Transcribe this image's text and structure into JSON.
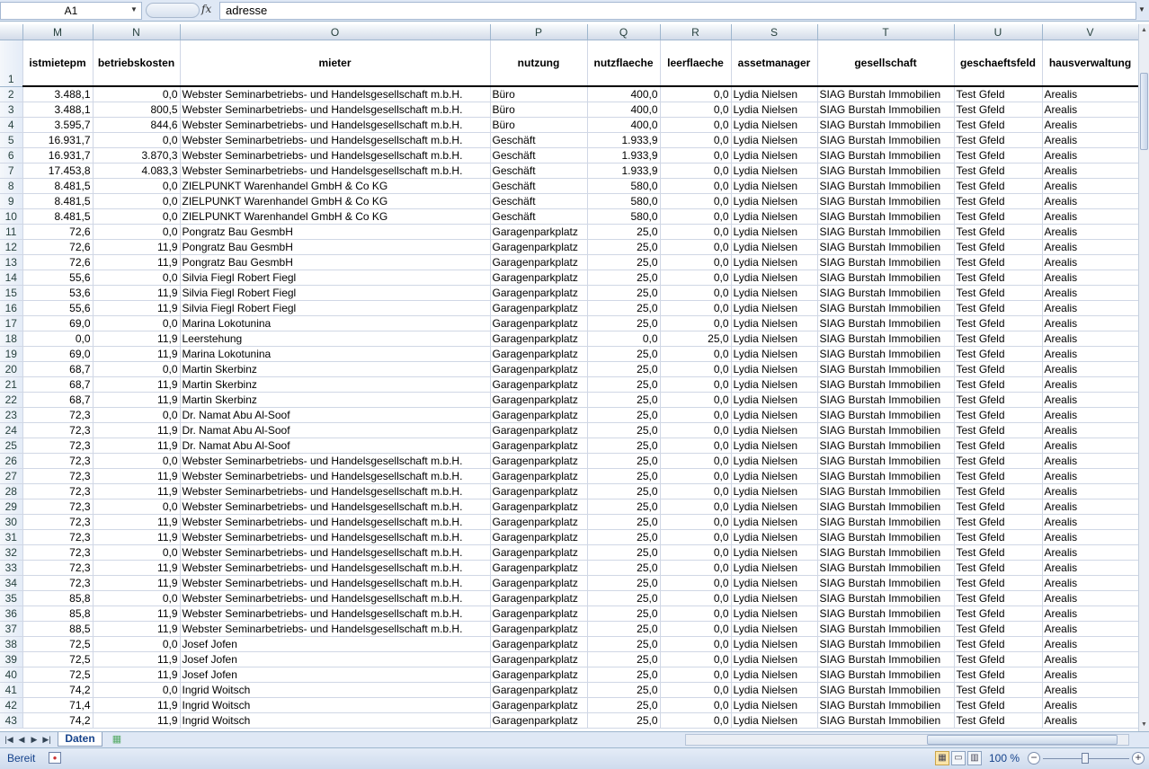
{
  "formula_bar": {
    "name_box": "A1",
    "fx": "fx",
    "content": "adresse"
  },
  "columns": [
    {
      "letter": "M",
      "header": "istmietepm"
    },
    {
      "letter": "N",
      "header": "betriebskosten"
    },
    {
      "letter": "O",
      "header": "mieter"
    },
    {
      "letter": "P",
      "header": "nutzung"
    },
    {
      "letter": "Q",
      "header": "nutzflaeche"
    },
    {
      "letter": "R",
      "header": "leerflaeche"
    },
    {
      "letter": "S",
      "header": "assetmanager"
    },
    {
      "letter": "T",
      "header": "gesellschaft"
    },
    {
      "letter": "U",
      "header": "geschaeftsfeld"
    },
    {
      "letter": "V",
      "header": "hausverwaltung"
    }
  ],
  "header_row_number": "1",
  "rows": [
    [
      "2",
      "3.488,1",
      "0,0",
      "Webster Seminarbetriebs- und Handelsgesellschaft m.b.H.",
      "Büro",
      "400,0",
      "0,0",
      "Lydia Nielsen",
      "SIAG Burstah Immobilien",
      "Test Gfeld",
      "Arealis"
    ],
    [
      "3",
      "3.488,1",
      "800,5",
      "Webster Seminarbetriebs- und Handelsgesellschaft m.b.H.",
      "Büro",
      "400,0",
      "0,0",
      "Lydia Nielsen",
      "SIAG Burstah Immobilien",
      "Test Gfeld",
      "Arealis"
    ],
    [
      "4",
      "3.595,7",
      "844,6",
      "Webster Seminarbetriebs- und Handelsgesellschaft m.b.H.",
      "Büro",
      "400,0",
      "0,0",
      "Lydia Nielsen",
      "SIAG Burstah Immobilien",
      "Test Gfeld",
      "Arealis"
    ],
    [
      "5",
      "16.931,7",
      "0,0",
      "Webster Seminarbetriebs- und Handelsgesellschaft m.b.H.",
      "Geschäft",
      "1.933,9",
      "0,0",
      "Lydia Nielsen",
      "SIAG Burstah Immobilien",
      "Test Gfeld",
      "Arealis"
    ],
    [
      "6",
      "16.931,7",
      "3.870,3",
      "Webster Seminarbetriebs- und Handelsgesellschaft m.b.H.",
      "Geschäft",
      "1.933,9",
      "0,0",
      "Lydia Nielsen",
      "SIAG Burstah Immobilien",
      "Test Gfeld",
      "Arealis"
    ],
    [
      "7",
      "17.453,8",
      "4.083,3",
      "Webster Seminarbetriebs- und Handelsgesellschaft m.b.H.",
      "Geschäft",
      "1.933,9",
      "0,0",
      "Lydia Nielsen",
      "SIAG Burstah Immobilien",
      "Test Gfeld",
      "Arealis"
    ],
    [
      "8",
      "8.481,5",
      "0,0",
      "ZIELPUNKT Warenhandel GmbH & Co KG",
      "Geschäft",
      "580,0",
      "0,0",
      "Lydia Nielsen",
      "SIAG Burstah Immobilien",
      "Test Gfeld",
      "Arealis"
    ],
    [
      "9",
      "8.481,5",
      "0,0",
      "ZIELPUNKT Warenhandel GmbH & Co KG",
      "Geschäft",
      "580,0",
      "0,0",
      "Lydia Nielsen",
      "SIAG Burstah Immobilien",
      "Test Gfeld",
      "Arealis"
    ],
    [
      "10",
      "8.481,5",
      "0,0",
      "ZIELPUNKT Warenhandel GmbH & Co KG",
      "Geschäft",
      "580,0",
      "0,0",
      "Lydia Nielsen",
      "SIAG Burstah Immobilien",
      "Test Gfeld",
      "Arealis"
    ],
    [
      "11",
      "72,6",
      "0,0",
      "Pongratz Bau GesmbH",
      "Garagenparkplatz",
      "25,0",
      "0,0",
      "Lydia Nielsen",
      "SIAG Burstah Immobilien",
      "Test Gfeld",
      "Arealis"
    ],
    [
      "12",
      "72,6",
      "11,9",
      "Pongratz Bau GesmbH",
      "Garagenparkplatz",
      "25,0",
      "0,0",
      "Lydia Nielsen",
      "SIAG Burstah Immobilien",
      "Test Gfeld",
      "Arealis"
    ],
    [
      "13",
      "72,6",
      "11,9",
      "Pongratz Bau GesmbH",
      "Garagenparkplatz",
      "25,0",
      "0,0",
      "Lydia Nielsen",
      "SIAG Burstah Immobilien",
      "Test Gfeld",
      "Arealis"
    ],
    [
      "14",
      "55,6",
      "0,0",
      "Silvia Fiegl Robert Fiegl",
      "Garagenparkplatz",
      "25,0",
      "0,0",
      "Lydia Nielsen",
      "SIAG Burstah Immobilien",
      "Test Gfeld",
      "Arealis"
    ],
    [
      "15",
      "53,6",
      "11,9",
      "Silvia Fiegl Robert Fiegl",
      "Garagenparkplatz",
      "25,0",
      "0,0",
      "Lydia Nielsen",
      "SIAG Burstah Immobilien",
      "Test Gfeld",
      "Arealis"
    ],
    [
      "16",
      "55,6",
      "11,9",
      "Silvia Fiegl Robert Fiegl",
      "Garagenparkplatz",
      "25,0",
      "0,0",
      "Lydia Nielsen",
      "SIAG Burstah Immobilien",
      "Test Gfeld",
      "Arealis"
    ],
    [
      "17",
      "69,0",
      "0,0",
      "Marina Lokotunina",
      "Garagenparkplatz",
      "25,0",
      "0,0",
      "Lydia Nielsen",
      "SIAG Burstah Immobilien",
      "Test Gfeld",
      "Arealis"
    ],
    [
      "18",
      "0,0",
      "11,9",
      "Leerstehung",
      "Garagenparkplatz",
      "0,0",
      "25,0",
      "Lydia Nielsen",
      "SIAG Burstah Immobilien",
      "Test Gfeld",
      "Arealis"
    ],
    [
      "19",
      "69,0",
      "11,9",
      "Marina Lokotunina",
      "Garagenparkplatz",
      "25,0",
      "0,0",
      "Lydia Nielsen",
      "SIAG Burstah Immobilien",
      "Test Gfeld",
      "Arealis"
    ],
    [
      "20",
      "68,7",
      "0,0",
      "Martin Skerbinz",
      "Garagenparkplatz",
      "25,0",
      "0,0",
      "Lydia Nielsen",
      "SIAG Burstah Immobilien",
      "Test Gfeld",
      "Arealis"
    ],
    [
      "21",
      "68,7",
      "11,9",
      "Martin Skerbinz",
      "Garagenparkplatz",
      "25,0",
      "0,0",
      "Lydia Nielsen",
      "SIAG Burstah Immobilien",
      "Test Gfeld",
      "Arealis"
    ],
    [
      "22",
      "68,7",
      "11,9",
      "Martin Skerbinz",
      "Garagenparkplatz",
      "25,0",
      "0,0",
      "Lydia Nielsen",
      "SIAG Burstah Immobilien",
      "Test Gfeld",
      "Arealis"
    ],
    [
      "23",
      "72,3",
      "0,0",
      "Dr. Namat Abu Al-Soof",
      "Garagenparkplatz",
      "25,0",
      "0,0",
      "Lydia Nielsen",
      "SIAG Burstah Immobilien",
      "Test Gfeld",
      "Arealis"
    ],
    [
      "24",
      "72,3",
      "11,9",
      "Dr. Namat Abu Al-Soof",
      "Garagenparkplatz",
      "25,0",
      "0,0",
      "Lydia Nielsen",
      "SIAG Burstah Immobilien",
      "Test Gfeld",
      "Arealis"
    ],
    [
      "25",
      "72,3",
      "11,9",
      "Dr. Namat Abu Al-Soof",
      "Garagenparkplatz",
      "25,0",
      "0,0",
      "Lydia Nielsen",
      "SIAG Burstah Immobilien",
      "Test Gfeld",
      "Arealis"
    ],
    [
      "26",
      "72,3",
      "0,0",
      "Webster Seminarbetriebs- und Handelsgesellschaft m.b.H.",
      "Garagenparkplatz",
      "25,0",
      "0,0",
      "Lydia Nielsen",
      "SIAG Burstah Immobilien",
      "Test Gfeld",
      "Arealis"
    ],
    [
      "27",
      "72,3",
      "11,9",
      "Webster Seminarbetriebs- und Handelsgesellschaft m.b.H.",
      "Garagenparkplatz",
      "25,0",
      "0,0",
      "Lydia Nielsen",
      "SIAG Burstah Immobilien",
      "Test Gfeld",
      "Arealis"
    ],
    [
      "28",
      "72,3",
      "11,9",
      "Webster Seminarbetriebs- und Handelsgesellschaft m.b.H.",
      "Garagenparkplatz",
      "25,0",
      "0,0",
      "Lydia Nielsen",
      "SIAG Burstah Immobilien",
      "Test Gfeld",
      "Arealis"
    ],
    [
      "29",
      "72,3",
      "0,0",
      "Webster Seminarbetriebs- und Handelsgesellschaft m.b.H.",
      "Garagenparkplatz",
      "25,0",
      "0,0",
      "Lydia Nielsen",
      "SIAG Burstah Immobilien",
      "Test Gfeld",
      "Arealis"
    ],
    [
      "30",
      "72,3",
      "11,9",
      "Webster Seminarbetriebs- und Handelsgesellschaft m.b.H.",
      "Garagenparkplatz",
      "25,0",
      "0,0",
      "Lydia Nielsen",
      "SIAG Burstah Immobilien",
      "Test Gfeld",
      "Arealis"
    ],
    [
      "31",
      "72,3",
      "11,9",
      "Webster Seminarbetriebs- und Handelsgesellschaft m.b.H.",
      "Garagenparkplatz",
      "25,0",
      "0,0",
      "Lydia Nielsen",
      "SIAG Burstah Immobilien",
      "Test Gfeld",
      "Arealis"
    ],
    [
      "32",
      "72,3",
      "0,0",
      "Webster Seminarbetriebs- und Handelsgesellschaft m.b.H.",
      "Garagenparkplatz",
      "25,0",
      "0,0",
      "Lydia Nielsen",
      "SIAG Burstah Immobilien",
      "Test Gfeld",
      "Arealis"
    ],
    [
      "33",
      "72,3",
      "11,9",
      "Webster Seminarbetriebs- und Handelsgesellschaft m.b.H.",
      "Garagenparkplatz",
      "25,0",
      "0,0",
      "Lydia Nielsen",
      "SIAG Burstah Immobilien",
      "Test Gfeld",
      "Arealis"
    ],
    [
      "34",
      "72,3",
      "11,9",
      "Webster Seminarbetriebs- und Handelsgesellschaft m.b.H.",
      "Garagenparkplatz",
      "25,0",
      "0,0",
      "Lydia Nielsen",
      "SIAG Burstah Immobilien",
      "Test Gfeld",
      "Arealis"
    ],
    [
      "35",
      "85,8",
      "0,0",
      "Webster Seminarbetriebs- und Handelsgesellschaft m.b.H.",
      "Garagenparkplatz",
      "25,0",
      "0,0",
      "Lydia Nielsen",
      "SIAG Burstah Immobilien",
      "Test Gfeld",
      "Arealis"
    ],
    [
      "36",
      "85,8",
      "11,9",
      "Webster Seminarbetriebs- und Handelsgesellschaft m.b.H.",
      "Garagenparkplatz",
      "25,0",
      "0,0",
      "Lydia Nielsen",
      "SIAG Burstah Immobilien",
      "Test Gfeld",
      "Arealis"
    ],
    [
      "37",
      "88,5",
      "11,9",
      "Webster Seminarbetriebs- und Handelsgesellschaft m.b.H.",
      "Garagenparkplatz",
      "25,0",
      "0,0",
      "Lydia Nielsen",
      "SIAG Burstah Immobilien",
      "Test Gfeld",
      "Arealis"
    ],
    [
      "38",
      "72,5",
      "0,0",
      "Josef Jofen",
      "Garagenparkplatz",
      "25,0",
      "0,0",
      "Lydia Nielsen",
      "SIAG Burstah Immobilien",
      "Test Gfeld",
      "Arealis"
    ],
    [
      "39",
      "72,5",
      "11,9",
      "Josef Jofen",
      "Garagenparkplatz",
      "25,0",
      "0,0",
      "Lydia Nielsen",
      "SIAG Burstah Immobilien",
      "Test Gfeld",
      "Arealis"
    ],
    [
      "40",
      "72,5",
      "11,9",
      "Josef Jofen",
      "Garagenparkplatz",
      "25,0",
      "0,0",
      "Lydia Nielsen",
      "SIAG Burstah Immobilien",
      "Test Gfeld",
      "Arealis"
    ],
    [
      "41",
      "74,2",
      "0,0",
      "Ingrid Woitsch",
      "Garagenparkplatz",
      "25,0",
      "0,0",
      "Lydia Nielsen",
      "SIAG Burstah Immobilien",
      "Test Gfeld",
      "Arealis"
    ],
    [
      "42",
      "71,4",
      "11,9",
      "Ingrid Woitsch",
      "Garagenparkplatz",
      "25,0",
      "0,0",
      "Lydia Nielsen",
      "SIAG Burstah Immobilien",
      "Test Gfeld",
      "Arealis"
    ],
    [
      "43",
      "74,2",
      "11,9",
      "Ingrid Woitsch",
      "Garagenparkplatz",
      "25,0",
      "0,0",
      "Lydia Nielsen",
      "SIAG Burstah Immobilien",
      "Test Gfeld",
      "Arealis"
    ]
  ],
  "sheet_tabs": {
    "active": "Daten"
  },
  "statusbar": {
    "status": "Bereit",
    "zoom": "100 %"
  }
}
